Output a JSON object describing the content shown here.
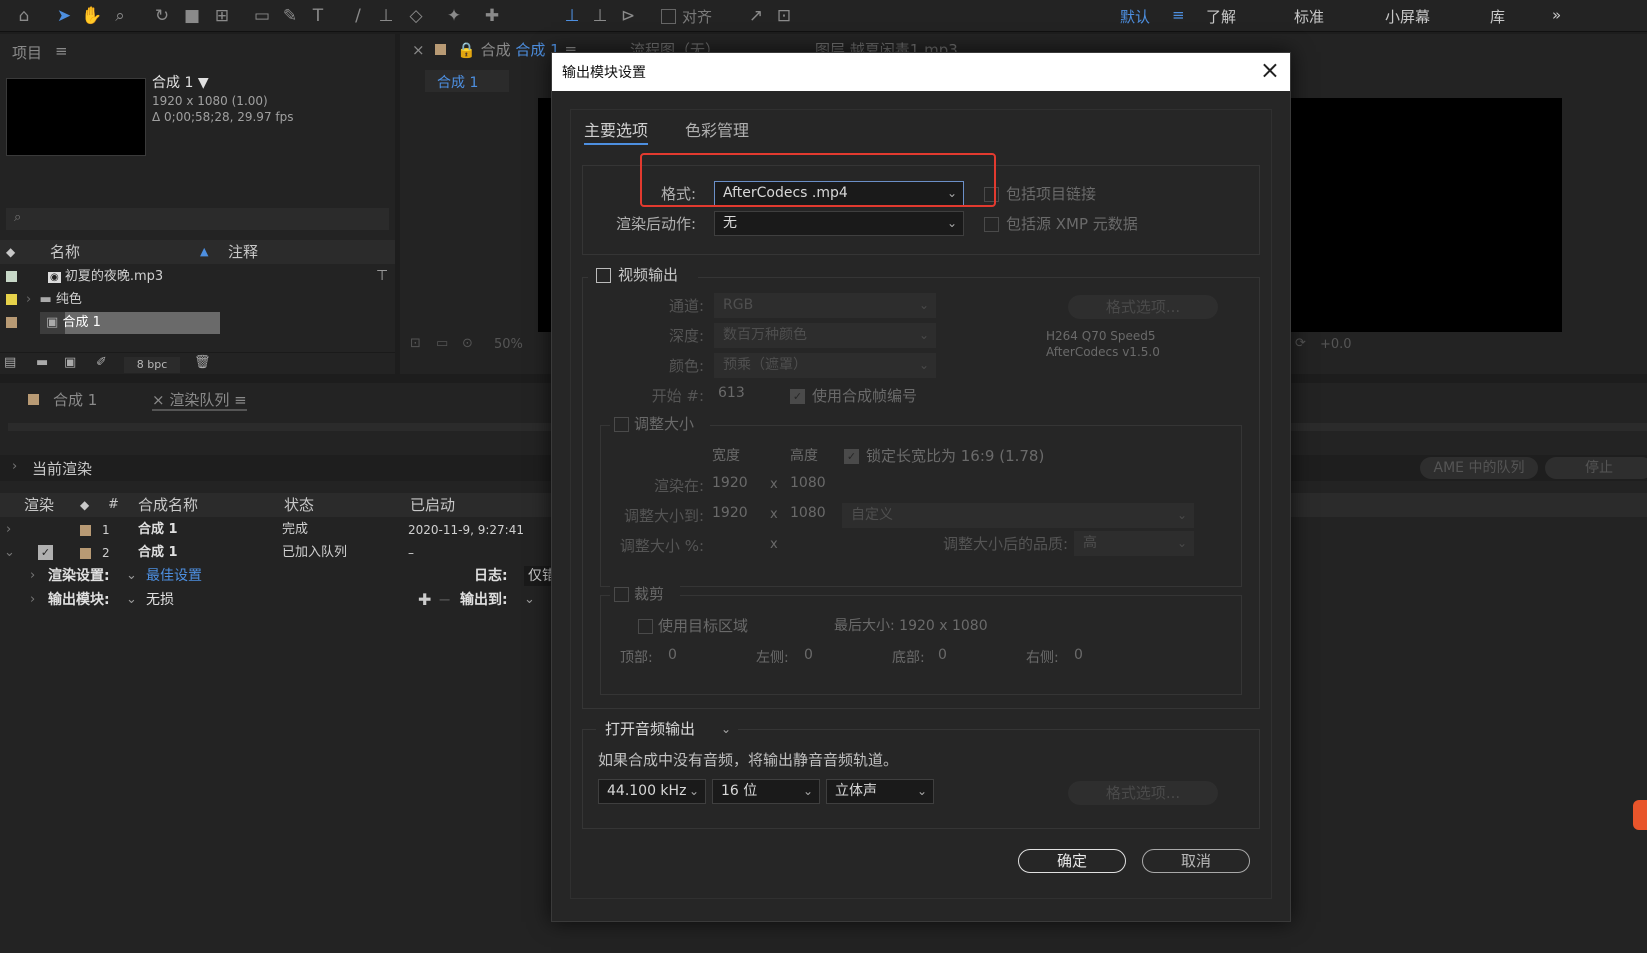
{
  "workspaces": [
    "默认",
    "了解",
    "标准",
    "小屏幕",
    "库"
  ],
  "workspace_menu_icon": "≡",
  "more_icon": "»",
  "toolbar": {
    "snap_label": "对齐"
  },
  "project": {
    "title": "项目",
    "comp_name": "合成 1",
    "comp_res": "1920 x 1080 (1.00)",
    "comp_dur": "Δ 0;00;58;28, 29.97 fps",
    "col_name": "名称",
    "col_comment": "注释",
    "items": [
      {
        "name": "初夏的夜晚.mp3",
        "color": "#c8d8c8"
      },
      {
        "name": "纯色",
        "color": "#e6d24a"
      },
      {
        "name": "合成 1",
        "color": "#b89a74"
      }
    ],
    "bpc": "8 bpc"
  },
  "viewer": {
    "tab_prefix": "合成",
    "tab_comp": "合成 1",
    "flow_tab": "流程图（无）",
    "layer_tab": "图层 越夏闲毒1.mp3",
    "sub_tab": "合成 1",
    "zoom": "50%",
    "exposure": "+0.0"
  },
  "render_queue": {
    "tab_comp": "合成 1",
    "tab_rq": "渲染队列",
    "current_render": "当前渲染",
    "ame_btn": "AME 中的队列",
    "stop_btn": "停止",
    "headers": {
      "render": "渲染",
      "num": "#",
      "comp": "合成名称",
      "status": "状态",
      "started": "已启动"
    },
    "rows": [
      {
        "num": "1",
        "comp": "合成 1",
        "status": "完成",
        "started": "2020-11-9, 9:27:41"
      },
      {
        "num": "2",
        "comp": "合成 1",
        "status": "已加入队列",
        "started": "–"
      }
    ],
    "render_settings_label": "渲染设置:",
    "render_settings_value": "最佳设置",
    "log_label": "日志:",
    "log_value": "仅错",
    "output_module_label": "输出模块:",
    "output_module_value": "无损",
    "output_to_label": "输出到:"
  },
  "dialog": {
    "title": "输出模块设置",
    "tabs": [
      "主要选项",
      "色彩管理"
    ],
    "format_label": "格式:",
    "format_value": "AfterCodecs .mp4",
    "post_render_label": "渲染后动作:",
    "post_render_value": "无",
    "include_project_link": "包括项目链接",
    "include_xmp": "包括源 XMP 元数据",
    "video_output": "视频输出",
    "channel_label": "通道:",
    "channel_value": "RGB",
    "depth_label": "深度:",
    "depth_value": "数百万种颜色",
    "color_label": "颜色:",
    "color_value": "预乘（遮罩）",
    "start_label": "开始 #:",
    "start_value": "613",
    "use_comp_frame": "使用合成帧编号",
    "format_options": "格式选项...",
    "codec_info_1": "H264 Q70 Speed5",
    "codec_info_2": "AfterCodecs v1.5.0",
    "resize": "调整大小",
    "width_hdr": "宽度",
    "height_hdr": "高度",
    "lock_aspect": "锁定长宽比为 16:9 (1.78)",
    "render_at_label": "渲染在:",
    "render_at_w": "1920",
    "render_at_h": "1080",
    "resize_to_label": "调整大小到:",
    "resize_to_w": "1920",
    "resize_to_h": "1080",
    "custom": "自定义",
    "resize_pct_label": "调整大小 %:",
    "x": "x",
    "quality_label": "调整大小后的品质:",
    "quality_value": "高",
    "crop": "裁剪",
    "use_roi": "使用目标区域",
    "final_size": "最后大小: 1920 x 1080",
    "top": "顶部:",
    "top_v": "0",
    "left": "左侧:",
    "left_v": "0",
    "bottom": "底部:",
    "bottom_v": "0",
    "right": "右侧:",
    "right_v": "0",
    "audio_output": "打开音频输出",
    "audio_note": "如果合成中没有音频，将输出静音音频轨道。",
    "sample_rate": "44.100 kHz",
    "bit_depth": "16 位",
    "channels": "立体声",
    "audio_format_options": "格式选项...",
    "ok": "确定",
    "cancel": "取消"
  }
}
